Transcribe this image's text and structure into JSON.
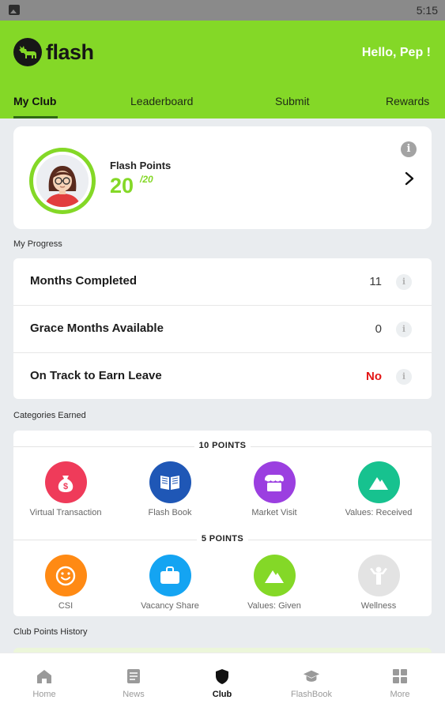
{
  "status_bar": {
    "time": "5:15"
  },
  "app": {
    "brand": "flash",
    "greeting": "Hello, Pep !"
  },
  "tabs": [
    {
      "label": "My Club",
      "active": true
    },
    {
      "label": "Leaderboard",
      "active": false
    },
    {
      "label": "Submit",
      "active": false
    },
    {
      "label": "Rewards",
      "active": false
    }
  ],
  "points_card": {
    "label": "Flash Points",
    "value": "20",
    "max": "/20"
  },
  "progress": {
    "title": "My Progress",
    "rows": [
      {
        "label": "Months Completed",
        "value": "11"
      },
      {
        "label": "Grace Months Available",
        "value": "0"
      },
      {
        "label": "On Track to Earn Leave",
        "value": "No"
      }
    ]
  },
  "categories": {
    "title": "Categories Earned",
    "groups": [
      {
        "heading": "10 POINTS",
        "items": [
          {
            "label": "Virtual Transaction",
            "icon": "money-bag-icon",
            "color": "#ef3b5a"
          },
          {
            "label": "Flash Book",
            "icon": "book-icon",
            "color": "#1f57b6"
          },
          {
            "label": "Market Visit",
            "icon": "shop-icon",
            "color": "#9b3fe0"
          },
          {
            "label": "Values: Received",
            "icon": "mountain-icon",
            "color": "#17c28f"
          }
        ]
      },
      {
        "heading": "5 POINTS",
        "items": [
          {
            "label": "CSI",
            "icon": "smiley-icon",
            "color": "#ff8a14"
          },
          {
            "label": "Vacancy Share",
            "icon": "briefcase-icon",
            "color": "#14a4f2"
          },
          {
            "label": "Values: Given",
            "icon": "mountain-icon",
            "color": "#84d827"
          },
          {
            "label": "Wellness",
            "icon": "person-stretch-icon",
            "color": "#e3e3e3"
          }
        ]
      }
    ]
  },
  "history": {
    "title": "Club Points History"
  },
  "bottom_nav": [
    {
      "label": "Home",
      "icon": "home-icon",
      "active": false
    },
    {
      "label": "News",
      "icon": "news-icon",
      "active": false
    },
    {
      "label": "Club",
      "icon": "shield-icon",
      "active": true
    },
    {
      "label": "FlashBook",
      "icon": "graduation-cap-icon",
      "active": false
    },
    {
      "label": "More",
      "icon": "grid-icon",
      "active": false
    }
  ],
  "colors": {
    "brand": "#84d827",
    "negative": "#e31515"
  }
}
